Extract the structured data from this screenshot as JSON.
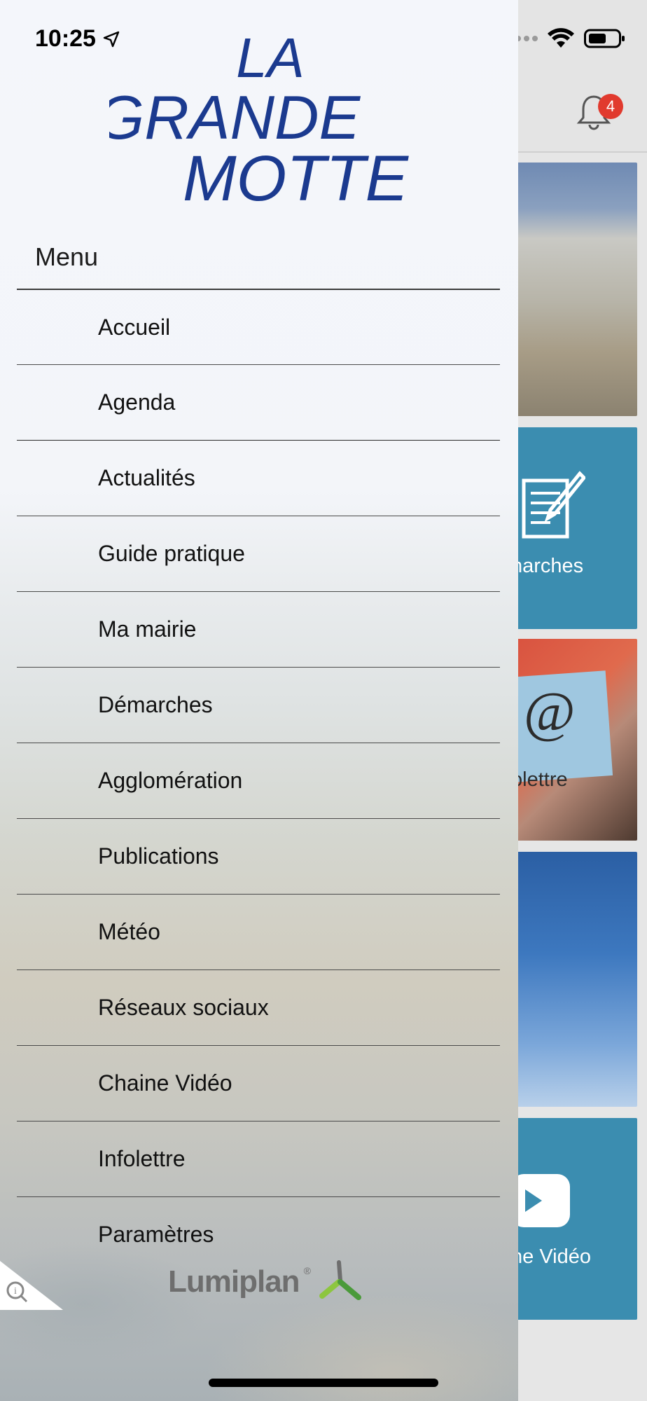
{
  "status_bar": {
    "time": "10:25",
    "signal_dots": "...."
  },
  "logo": {
    "line1": "LA",
    "line2": "GRANDE",
    "line3": "MOTTE",
    "color": "#1b3a8f"
  },
  "menu": {
    "heading": "Menu",
    "items": [
      {
        "label": "Accueil"
      },
      {
        "label": "Agenda"
      },
      {
        "label": "Actualités"
      },
      {
        "label": "Guide pratique"
      },
      {
        "label": "Ma mairie"
      },
      {
        "label": "Démarches"
      },
      {
        "label": "Agglomération"
      },
      {
        "label": "Publications"
      },
      {
        "label": "Météo"
      },
      {
        "label": "Réseaux sociaux"
      },
      {
        "label": "Chaine Vidéo"
      },
      {
        "label": "Infolettre"
      },
      {
        "label": "Paramètres"
      }
    ]
  },
  "footer": {
    "brand": "Lumiplan",
    "registered_mark": "®"
  },
  "background_app": {
    "notification_count": "4",
    "tiles": {
      "demarches_label": "narches",
      "infolettre_label": "olettre",
      "video_label": "ne Vidéo"
    }
  },
  "colors": {
    "tile_blue": "#3b8db0",
    "badge_red": "#e13a2e",
    "logo_blue": "#1b3a8f",
    "lumiplan_green": "#8dc63f"
  }
}
